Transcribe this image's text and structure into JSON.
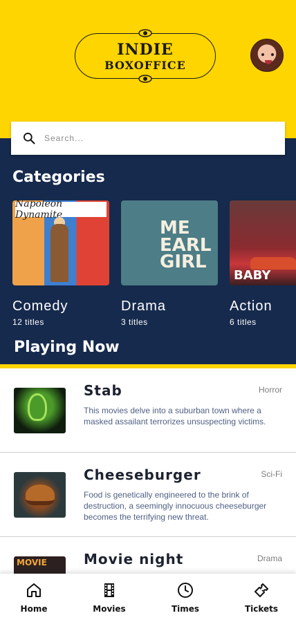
{
  "header": {
    "logo_line1": "INDIE",
    "logo_line2": "BOXOFFICE",
    "brand_color": "#ffd500"
  },
  "search": {
    "placeholder": "Search..."
  },
  "categories": {
    "title": "Categories",
    "items": [
      {
        "name": "Comedy",
        "count": "12 titles",
        "poster_text": "Napoleon Dynamite"
      },
      {
        "name": "Drama",
        "count": "3 titles",
        "poster_text": "ME EARL GIRL"
      },
      {
        "name": "Action",
        "count": "6 titles",
        "poster_text": "BABY"
      }
    ]
  },
  "playing_now": {
    "title": "Playing Now",
    "movies": [
      {
        "title": "Stab",
        "genre": "Horror",
        "description": "This movies delve into a suburban town where a masked assailant terrorizes unsuspecting victims."
      },
      {
        "title": "Cheeseburger",
        "genre": "Sci-Fi",
        "description": "Food is genetically engineered to the brink of destruction, a seemingly innocuous cheeseburger becomes the  terrifying new threat."
      },
      {
        "title": "Movie night",
        "genre": "Drama",
        "description": "",
        "poster_text": "MOVIE"
      }
    ]
  },
  "bottom_nav": {
    "items": [
      {
        "label": "Home",
        "icon": "home-icon"
      },
      {
        "label": "Movies",
        "icon": "film-icon"
      },
      {
        "label": "Times",
        "icon": "clock-icon"
      },
      {
        "label": "Tickets",
        "icon": "ticket-icon"
      }
    ]
  },
  "colors": {
    "dark_navy": "#162a4d",
    "yellow": "#ffd500",
    "desc_text": "#4e5f84"
  }
}
